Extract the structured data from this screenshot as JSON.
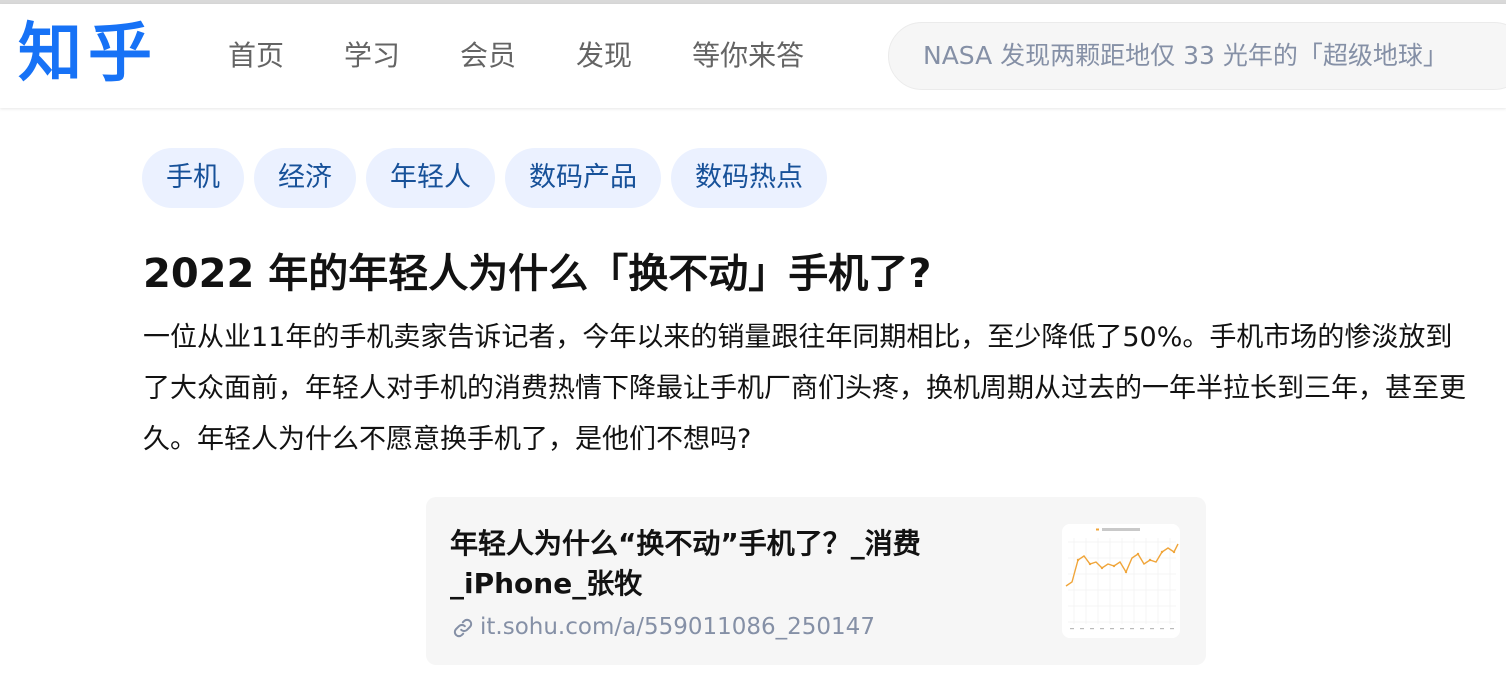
{
  "brand": {
    "logo": "知乎",
    "color": "#1772f6"
  },
  "nav": [
    {
      "label": "首页"
    },
    {
      "label": "学习"
    },
    {
      "label": "会员"
    },
    {
      "label": "发现"
    },
    {
      "label": "等你来答"
    }
  ],
  "search": {
    "placeholder": "NASA 发现两颗距地仅 33 光年的「超级地球」"
  },
  "tags": [
    {
      "label": "手机"
    },
    {
      "label": "经济"
    },
    {
      "label": "年轻人"
    },
    {
      "label": "数码产品"
    },
    {
      "label": "数码热点"
    }
  ],
  "question": {
    "title": "2022 年的年轻人为什么「换不动」手机了?",
    "excerpt": "一位从业11年的手机卖家告诉记者，今年以来的销量跟往年同期相比，至少降低了50%。手机市场的惨淡放到了大众面前，年轻人对手机的消费热情下降最让手机厂商们头疼，换机周期从过去的一年半拉长到三年，甚至更久。年轻人为什么不愿意换手机了，是他们不想吗?"
  },
  "link_card": {
    "title": "年轻人为什么“换不动”手机了？_消费_iPhone_张牧",
    "url": "it.sohu.com/a/559011086_250147",
    "link_icon": "link-icon",
    "thumbnail": "chart-thumbnail"
  }
}
